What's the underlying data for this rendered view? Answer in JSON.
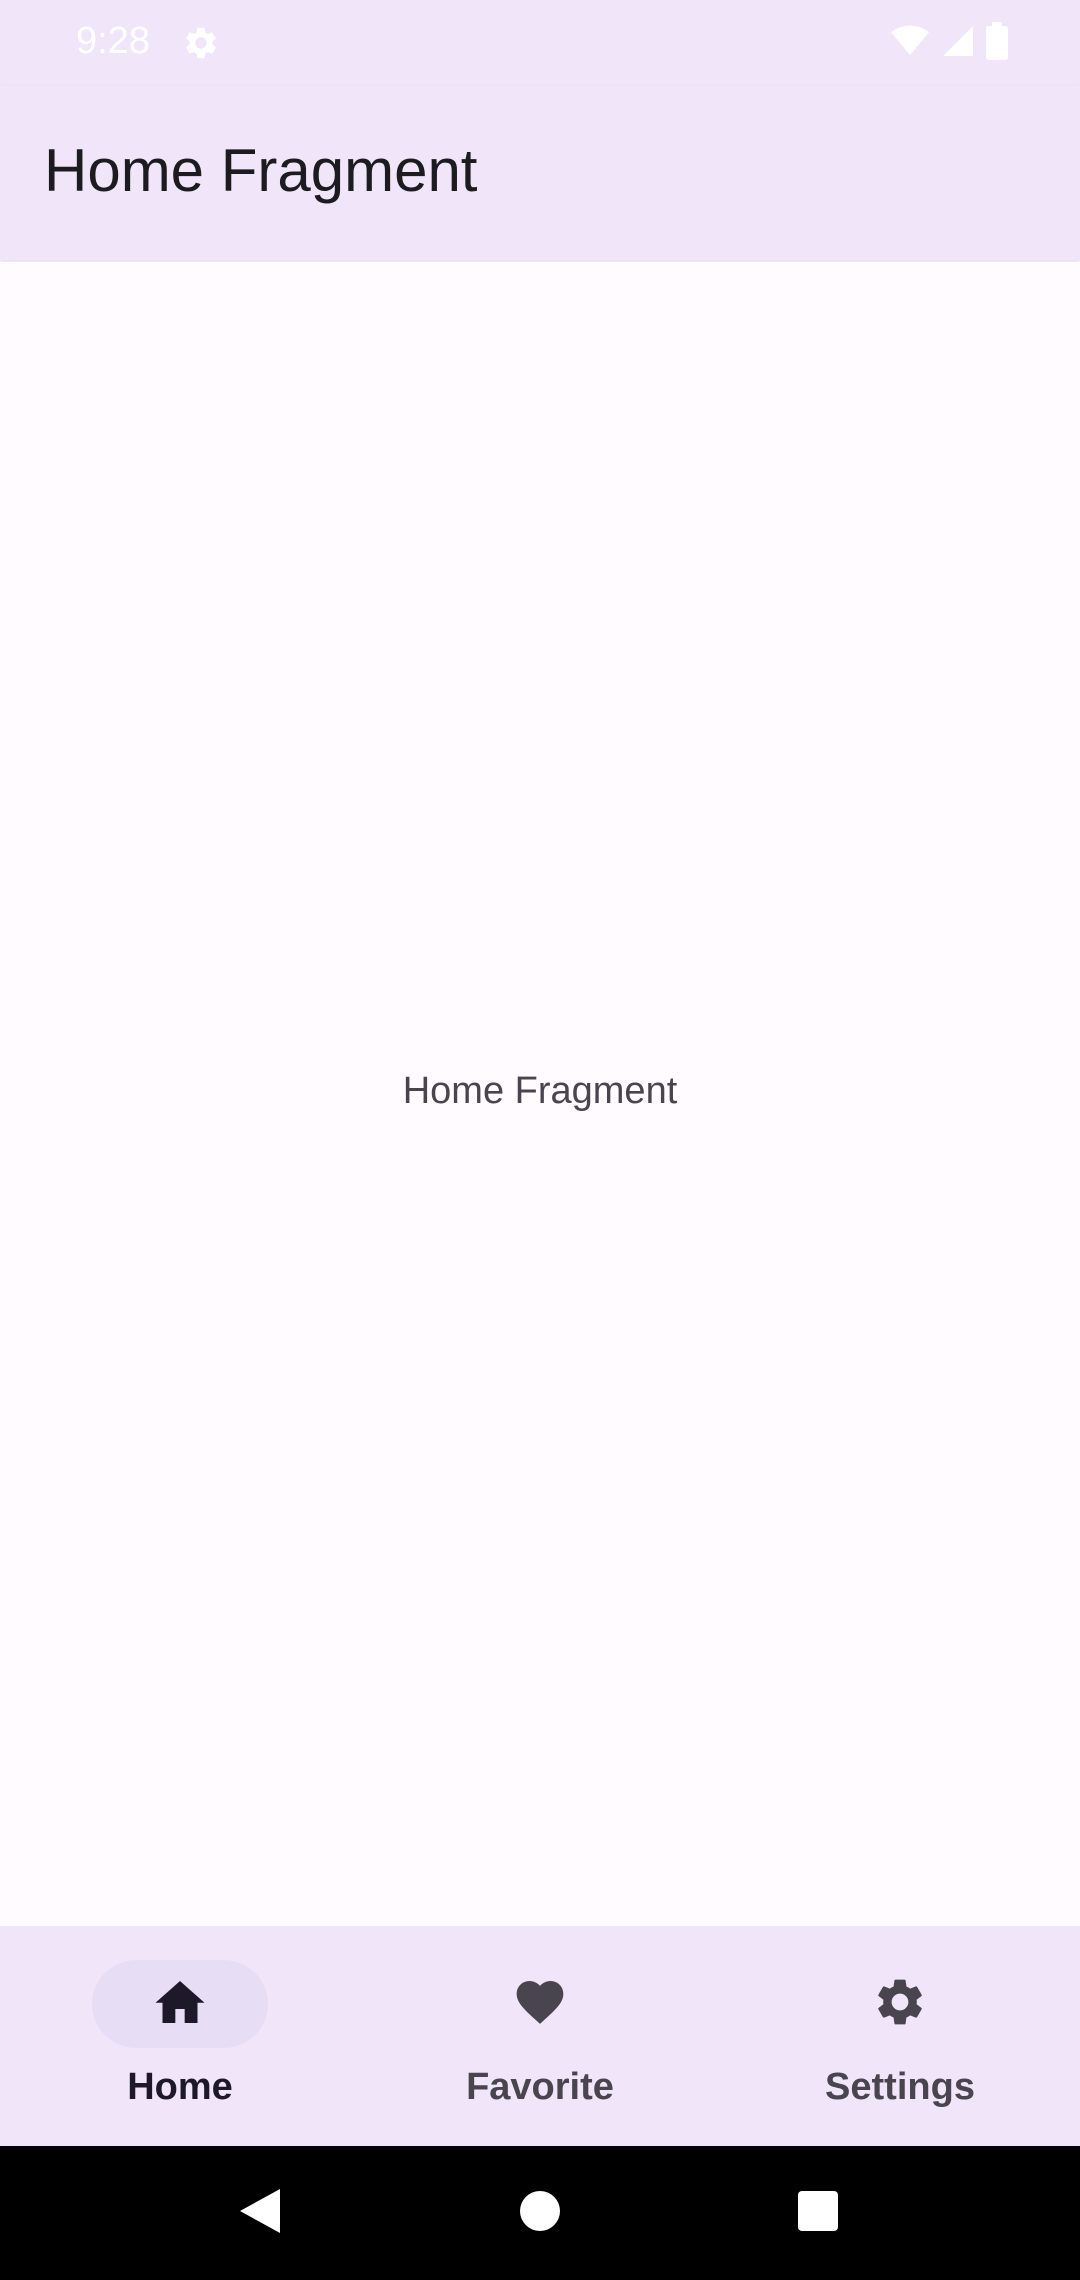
{
  "status_bar": {
    "time": "9:28",
    "settings_icon": "gear-icon",
    "wifi_icon": "wifi-icon",
    "signal_icon": "cellular-signal-icon",
    "battery_icon": "battery-icon"
  },
  "app_bar": {
    "title": "Home Fragment"
  },
  "content": {
    "text": "Home Fragment"
  },
  "bottom_nav": {
    "items": [
      {
        "label": "Home",
        "icon": "home-icon",
        "selected": true
      },
      {
        "label": "Favorite",
        "icon": "heart-icon",
        "selected": false
      },
      {
        "label": "Settings",
        "icon": "gear-icon",
        "selected": false
      }
    ]
  },
  "system_nav": {
    "back_icon": "back-triangle-icon",
    "home_icon": "home-circle-icon",
    "recents_icon": "recents-square-icon"
  },
  "colors": {
    "surface_tint": "#f1e5fa",
    "background": "#fffbfe",
    "active_indicator": "#e7def5",
    "on_surface": "#1c1b1f",
    "on_surface_variant": "#49454f"
  }
}
